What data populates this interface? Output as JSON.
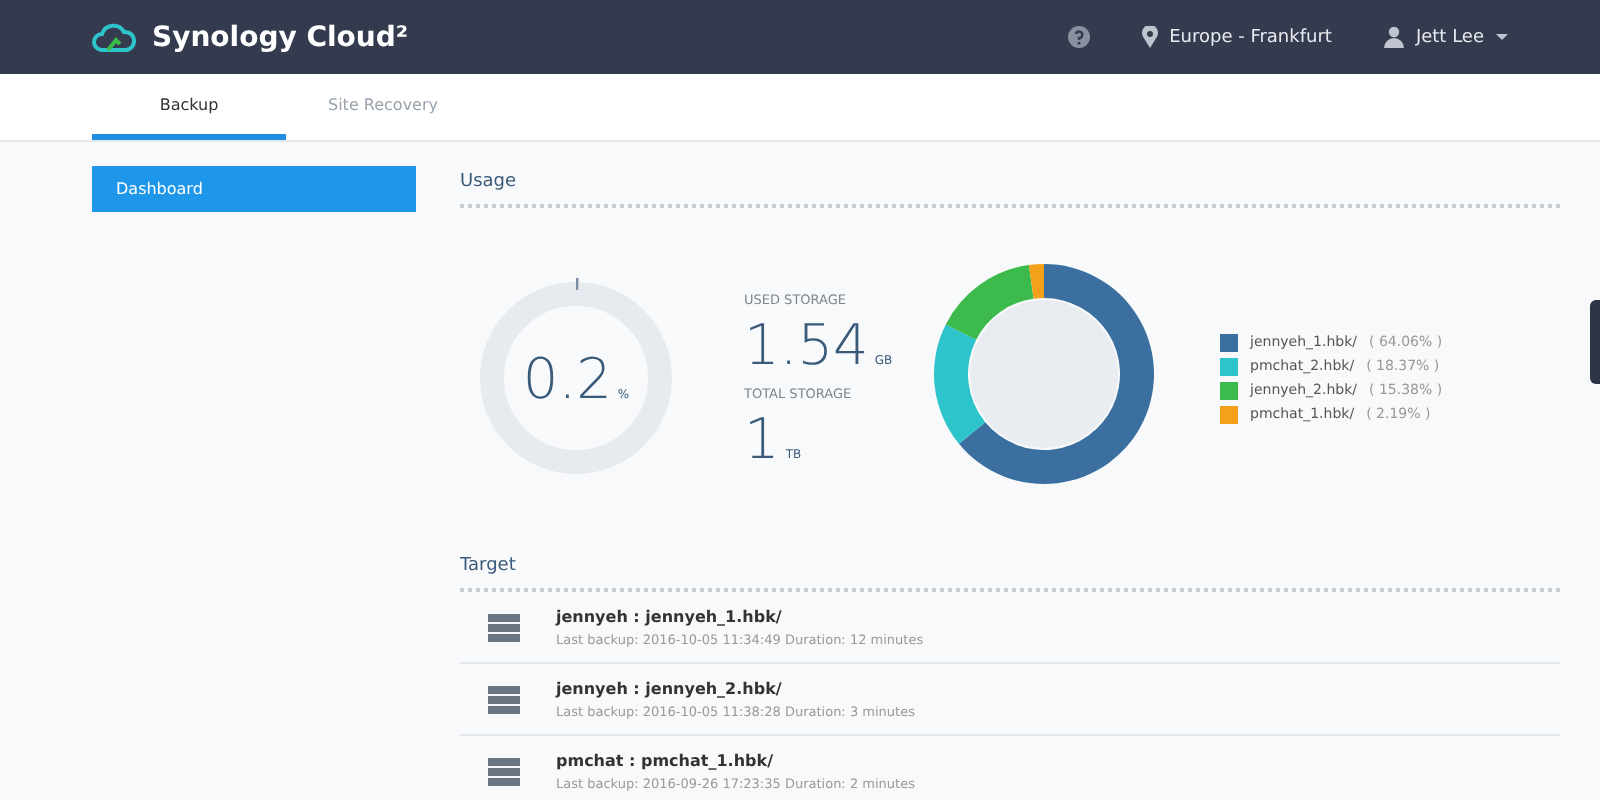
{
  "header": {
    "app_name": "Synology Cloud²",
    "region": "Europe - Frankfurt",
    "user": "Jett Lee"
  },
  "tabs": [
    {
      "label": "Backup",
      "selected": true
    },
    {
      "label": "Site Recovery",
      "selected": false
    }
  ],
  "sidebar": {
    "items": [
      {
        "label": "Dashboard",
        "selected": true
      }
    ]
  },
  "usage": {
    "title": "Usage",
    "gauge": {
      "value": "0.2",
      "unit": "%"
    },
    "used_storage": {
      "label": "USED STORAGE",
      "value": "1.54",
      "unit": "GB"
    },
    "total_storage": {
      "label": "TOTAL STORAGE",
      "value": "1",
      "unit": "TB"
    },
    "chart_data": {
      "type": "donut",
      "categories": [
        "jennyeh_1.hbk/",
        "pmchat_2.hbk/",
        "jennyeh_2.hbk/",
        "pmchat_1.hbk/"
      ],
      "values": [
        64.06,
        18.37,
        15.38,
        2.19
      ]
    },
    "legend": [
      {
        "percent": "( 64.06% )",
        "color": "#3a6fa0"
      },
      {
        "percent": "( 18.37% )",
        "color": "#2ec4cc"
      },
      {
        "percent": "( 15.38% )",
        "color": "#3cba4c"
      },
      {
        "percent": "( 2.19% )",
        "color": "#f5a01a"
      }
    ]
  },
  "target": {
    "title": "Target",
    "rows": [
      {
        "name": "jennyeh : jennyeh_1.hbk/",
        "detail": "Last backup: 2016-10-05 11:34:49 Duration: 12 minutes"
      },
      {
        "name": "jennyeh : jennyeh_2.hbk/",
        "detail": "Last backup: 2016-10-05 11:38:28 Duration: 3 minutes"
      },
      {
        "name": "pmchat : pmchat_1.hbk/",
        "detail": "Last backup: 2016-09-26 17:23:35 Duration: 2 minutes"
      }
    ]
  }
}
